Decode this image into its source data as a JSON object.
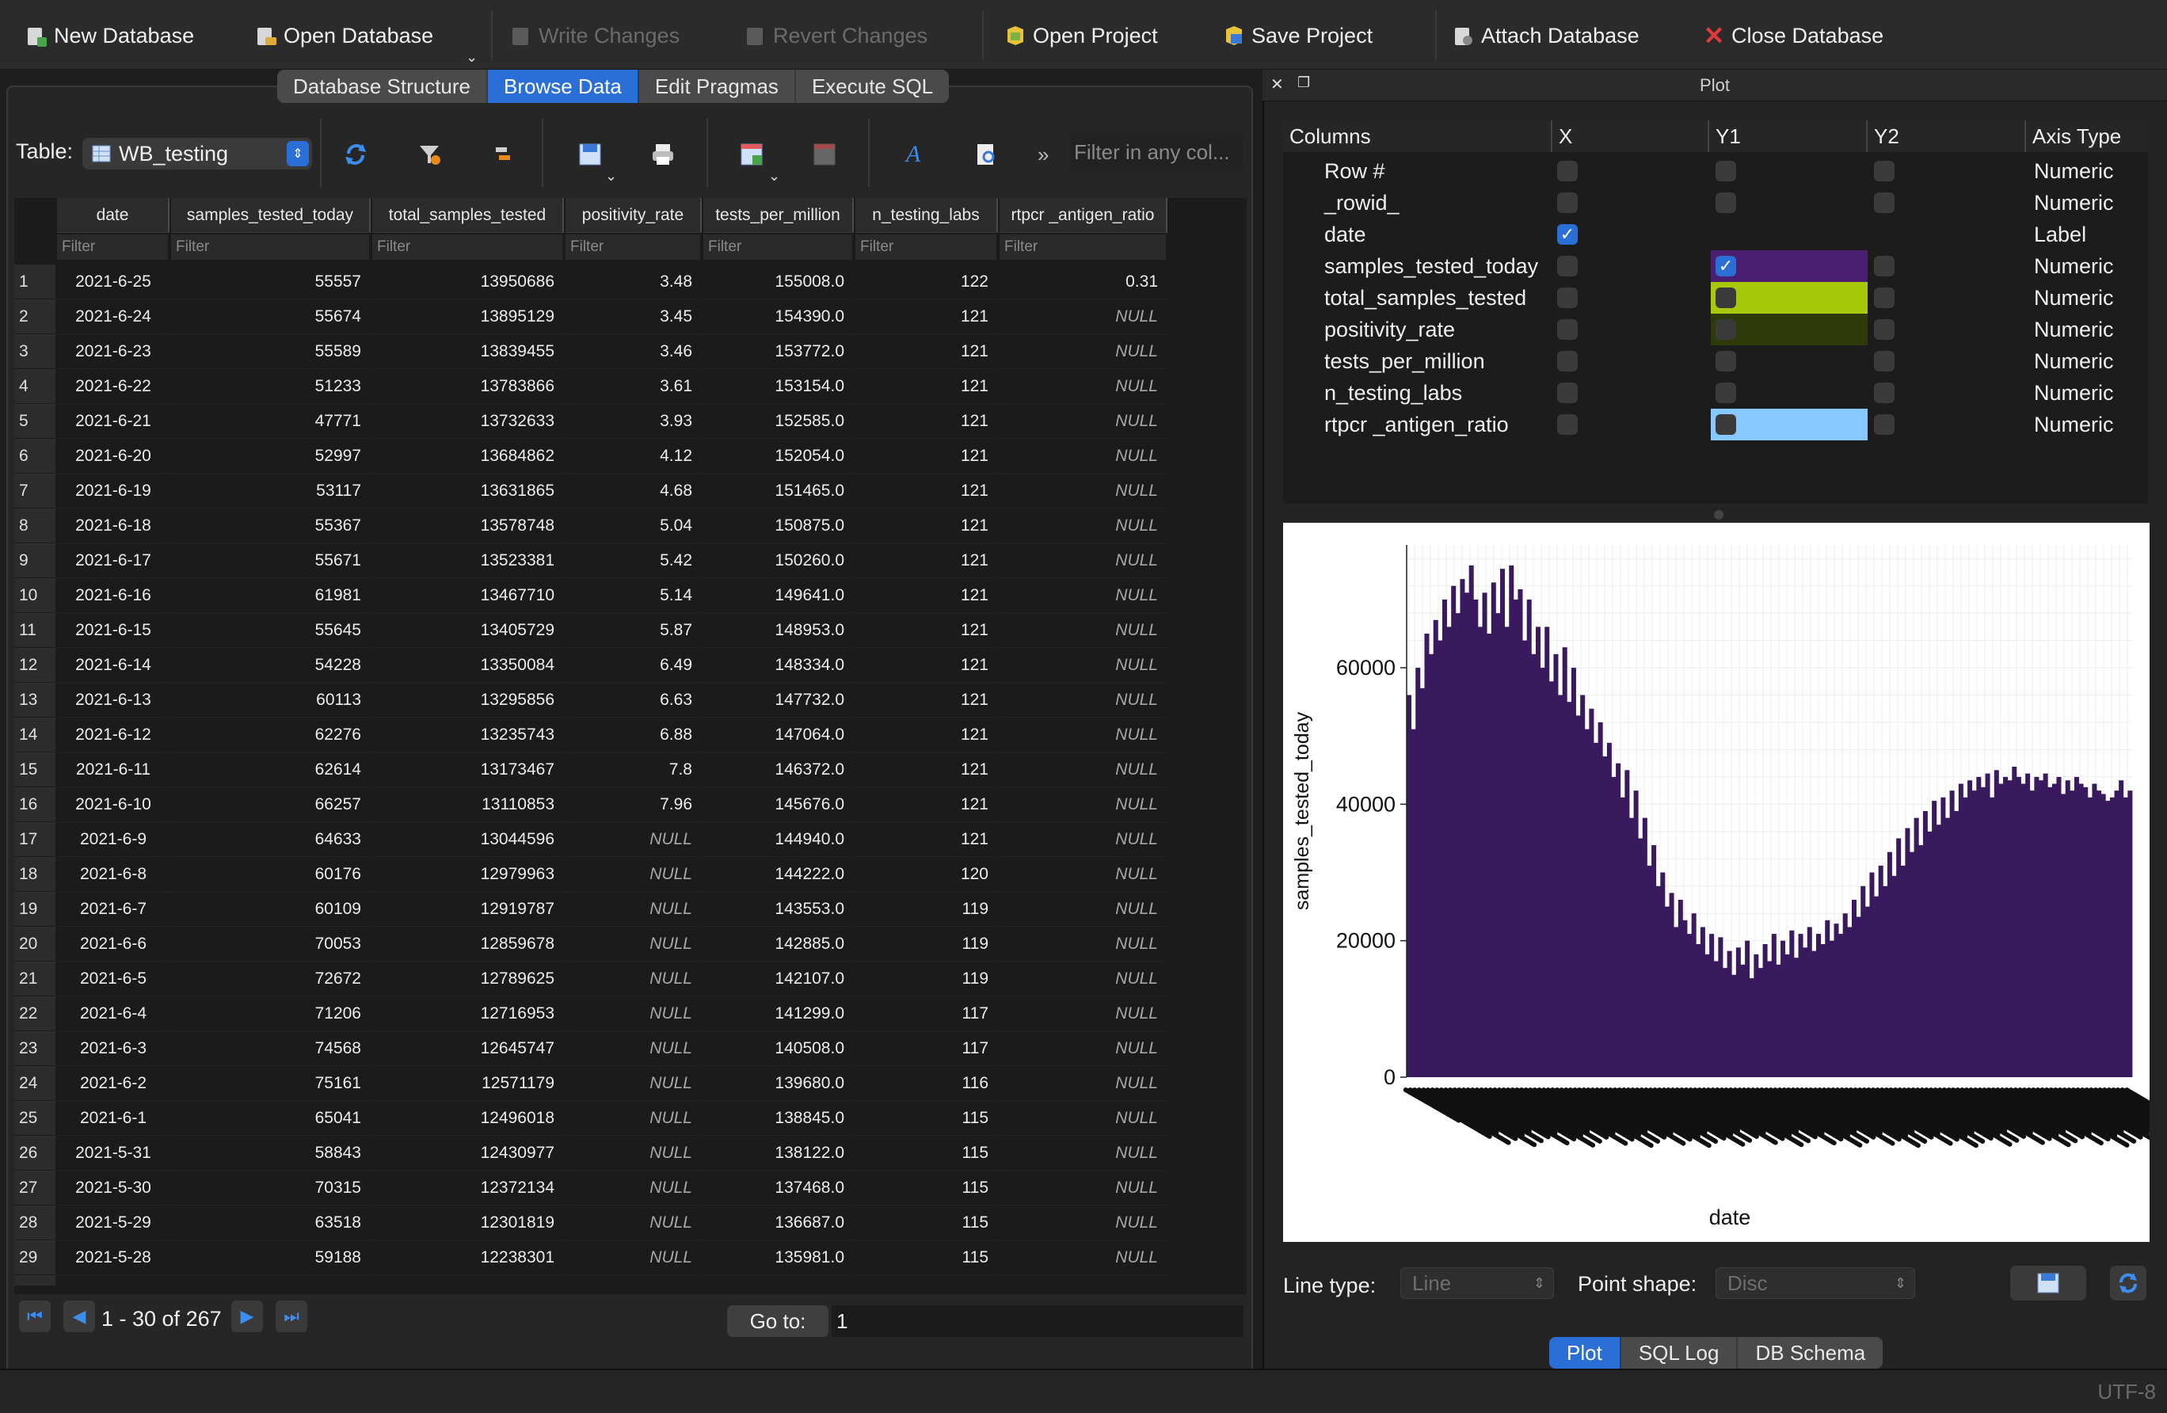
{
  "toolbar": {
    "new_database": "New Database",
    "open_database": "Open Database",
    "write_changes": "Write Changes",
    "revert_changes": "Revert Changes",
    "open_project": "Open Project",
    "save_project": "Save Project",
    "attach_database": "Attach Database",
    "close_database": "Close Database"
  },
  "main_tabs": [
    "Database Structure",
    "Browse Data",
    "Edit Pragmas",
    "Execute SQL"
  ],
  "browse": {
    "table_label": "Table:",
    "table_name": "WB_testing",
    "filter_placeholder": "Filter in any col...",
    "columns": [
      "date",
      "samples_tested_today",
      "total_samples_tested",
      "positivity_rate",
      "tests_per_million",
      "n_testing_labs",
      "rtpcr _antigen_ratio"
    ],
    "filter_label": "Filter",
    "rows": [
      [
        "1",
        "2021-6-25",
        "55557",
        "13950686",
        "3.48",
        "155008.0",
        "122",
        "0.31"
      ],
      [
        "2",
        "2021-6-24",
        "55674",
        "13895129",
        "3.45",
        "154390.0",
        "121",
        "NULL"
      ],
      [
        "3",
        "2021-6-23",
        "55589",
        "13839455",
        "3.46",
        "153772.0",
        "121",
        "NULL"
      ],
      [
        "4",
        "2021-6-22",
        "51233",
        "13783866",
        "3.61",
        "153154.0",
        "121",
        "NULL"
      ],
      [
        "5",
        "2021-6-21",
        "47771",
        "13732633",
        "3.93",
        "152585.0",
        "121",
        "NULL"
      ],
      [
        "6",
        "2021-6-20",
        "52997",
        "13684862",
        "4.12",
        "152054.0",
        "121",
        "NULL"
      ],
      [
        "7",
        "2021-6-19",
        "53117",
        "13631865",
        "4.68",
        "151465.0",
        "121",
        "NULL"
      ],
      [
        "8",
        "2021-6-18",
        "55367",
        "13578748",
        "5.04",
        "150875.0",
        "121",
        "NULL"
      ],
      [
        "9",
        "2021-6-17",
        "55671",
        "13523381",
        "5.42",
        "150260.0",
        "121",
        "NULL"
      ],
      [
        "10",
        "2021-6-16",
        "61981",
        "13467710",
        "5.14",
        "149641.0",
        "121",
        "NULL"
      ],
      [
        "11",
        "2021-6-15",
        "55645",
        "13405729",
        "5.87",
        "148953.0",
        "121",
        "NULL"
      ],
      [
        "12",
        "2021-6-14",
        "54228",
        "13350084",
        "6.49",
        "148334.0",
        "121",
        "NULL"
      ],
      [
        "13",
        "2021-6-13",
        "60113",
        "13295856",
        "6.63",
        "147732.0",
        "121",
        "NULL"
      ],
      [
        "14",
        "2021-6-12",
        "62276",
        "13235743",
        "6.88",
        "147064.0",
        "121",
        "NULL"
      ],
      [
        "15",
        "2021-6-11",
        "62614",
        "13173467",
        "7.8",
        "146372.0",
        "121",
        "NULL"
      ],
      [
        "16",
        "2021-6-10",
        "66257",
        "13110853",
        "7.96",
        "145676.0",
        "121",
        "NULL"
      ],
      [
        "17",
        "2021-6-9",
        "64633",
        "13044596",
        "NULL",
        "144940.0",
        "121",
        "NULL"
      ],
      [
        "18",
        "2021-6-8",
        "60176",
        "12979963",
        "NULL",
        "144222.0",
        "120",
        "NULL"
      ],
      [
        "19",
        "2021-6-7",
        "60109",
        "12919787",
        "NULL",
        "143553.0",
        "119",
        "NULL"
      ],
      [
        "20",
        "2021-6-6",
        "70053",
        "12859678",
        "NULL",
        "142885.0",
        "119",
        "NULL"
      ],
      [
        "21",
        "2021-6-5",
        "72672",
        "12789625",
        "NULL",
        "142107.0",
        "119",
        "NULL"
      ],
      [
        "22",
        "2021-6-4",
        "71206",
        "12716953",
        "NULL",
        "141299.0",
        "117",
        "NULL"
      ],
      [
        "23",
        "2021-6-3",
        "74568",
        "12645747",
        "NULL",
        "140508.0",
        "117",
        "NULL"
      ],
      [
        "24",
        "2021-6-2",
        "75161",
        "12571179",
        "NULL",
        "139680.0",
        "116",
        "NULL"
      ],
      [
        "25",
        "2021-6-1",
        "65041",
        "12496018",
        "NULL",
        "138845.0",
        "115",
        "NULL"
      ],
      [
        "26",
        "2021-5-31",
        "58843",
        "12430977",
        "NULL",
        "138122.0",
        "115",
        "NULL"
      ],
      [
        "27",
        "2021-5-30",
        "70315",
        "12372134",
        "NULL",
        "137468.0",
        "115",
        "NULL"
      ],
      [
        "28",
        "2021-5-29",
        "63518",
        "12301819",
        "NULL",
        "136687.0",
        "115",
        "NULL"
      ],
      [
        "29",
        "2021-5-28",
        "59188",
        "12238301",
        "NULL",
        "135981.0",
        "115",
        "NULL"
      ]
    ],
    "pagination": "1 - 30 of 267",
    "goto_label": "Go to:",
    "goto_value": "1"
  },
  "plot_panel": {
    "title": "Plot",
    "headers": [
      "Columns",
      "X",
      "Y1",
      "Y2",
      "Axis Type"
    ],
    "columns": [
      {
        "name": "Row #",
        "x": false,
        "y1": false,
        "y2": false,
        "axis_type": "Numeric",
        "color": ""
      },
      {
        "name": "_rowid_",
        "x": false,
        "y1": false,
        "y2": false,
        "axis_type": "Numeric",
        "color": ""
      },
      {
        "name": "date",
        "x": true,
        "y1": null,
        "y2": null,
        "axis_type": "Label",
        "color": ""
      },
      {
        "name": "samples_tested_today",
        "x": false,
        "y1": true,
        "y2": false,
        "axis_type": "Numeric",
        "color": "#4a1f72"
      },
      {
        "name": "total_samples_tested",
        "x": false,
        "y1": false,
        "y2": false,
        "axis_type": "Numeric",
        "color": "#a8c80a"
      },
      {
        "name": "positivity_rate",
        "x": false,
        "y1": false,
        "y2": false,
        "axis_type": "Numeric",
        "color": "#2e3a08"
      },
      {
        "name": "tests_per_million",
        "x": false,
        "y1": false,
        "y2": false,
        "axis_type": "Numeric",
        "color": ""
      },
      {
        "name": "n_testing_labs",
        "x": false,
        "y1": false,
        "y2": false,
        "axis_type": "Numeric",
        "color": ""
      },
      {
        "name": "rtpcr _antigen_ratio",
        "x": false,
        "y1": false,
        "y2": false,
        "axis_type": "Numeric",
        "color": "#86c8ff"
      }
    ],
    "line_type_label": "Line type:",
    "line_type_value": "Line",
    "point_shape_label": "Point shape:",
    "point_shape_value": "Disc"
  },
  "chart_data": {
    "type": "bar",
    "xlabel": "date",
    "ylabel": "samples_tested_today",
    "ylim": [
      0,
      78000
    ],
    "yticks": [
      "0",
      "20000",
      "40000",
      "60000"
    ],
    "bar_color": "#3a1a5e",
    "grid": true,
    "note": "x tick labels are unreadable overlapping dates",
    "values": [
      56000,
      51000,
      60000,
      57000,
      65000,
      62000,
      67000,
      64000,
      70000,
      66000,
      72000,
      68000,
      73000,
      71000,
      75000,
      70000,
      66000,
      71000,
      65000,
      72500,
      68000,
      74500,
      66000,
      75000,
      70000,
      71500,
      64000,
      70000,
      62000,
      66000,
      60000,
      66000,
      58000,
      62000,
      56000,
      63000,
      55000,
      60000,
      53000,
      56000,
      51000,
      54000,
      49000,
      52000,
      47000,
      49000,
      44000,
      46000,
      41000,
      45000,
      38000,
      42000,
      35000,
      38000,
      31000,
      34000,
      28000,
      30000,
      25000,
      27000,
      22000,
      26000,
      23000,
      21000,
      24000,
      19500,
      22000,
      18000,
      21000,
      17000,
      20500,
      16000,
      18500,
      15000,
      19000,
      16500,
      20000,
      14500,
      18000,
      16000,
      19500,
      17000,
      21000,
      16500,
      20000,
      18000,
      21500,
      17500,
      21000,
      19000,
      22000,
      18500,
      21000,
      19500,
      23000,
      20000,
      22500,
      21000,
      24000,
      22000,
      26000,
      23500,
      28000,
      25000,
      30000,
      26500,
      31000,
      28000,
      33000,
      29500,
      35000,
      31000,
      36500,
      33000,
      38000,
      34000,
      39000,
      36000,
      40500,
      37000,
      41000,
      38000,
      42000,
      39000,
      43000,
      41000,
      43500,
      42000,
      44000,
      42500,
      44500,
      41000,
      45000,
      43000,
      44000,
      43500,
      45500,
      44000,
      43000,
      44500,
      42000,
      44000,
      43500,
      44500,
      42500,
      43000,
      44000,
      41500,
      43500,
      42000,
      44000,
      43000,
      42500,
      41000,
      43000,
      42000,
      41500,
      40500,
      41000,
      42000,
      43500,
      41000,
      42000
    ]
  },
  "bottom_tabs": [
    "Plot",
    "SQL Log",
    "DB Schema"
  ],
  "status": {
    "encoding": "UTF-8"
  }
}
